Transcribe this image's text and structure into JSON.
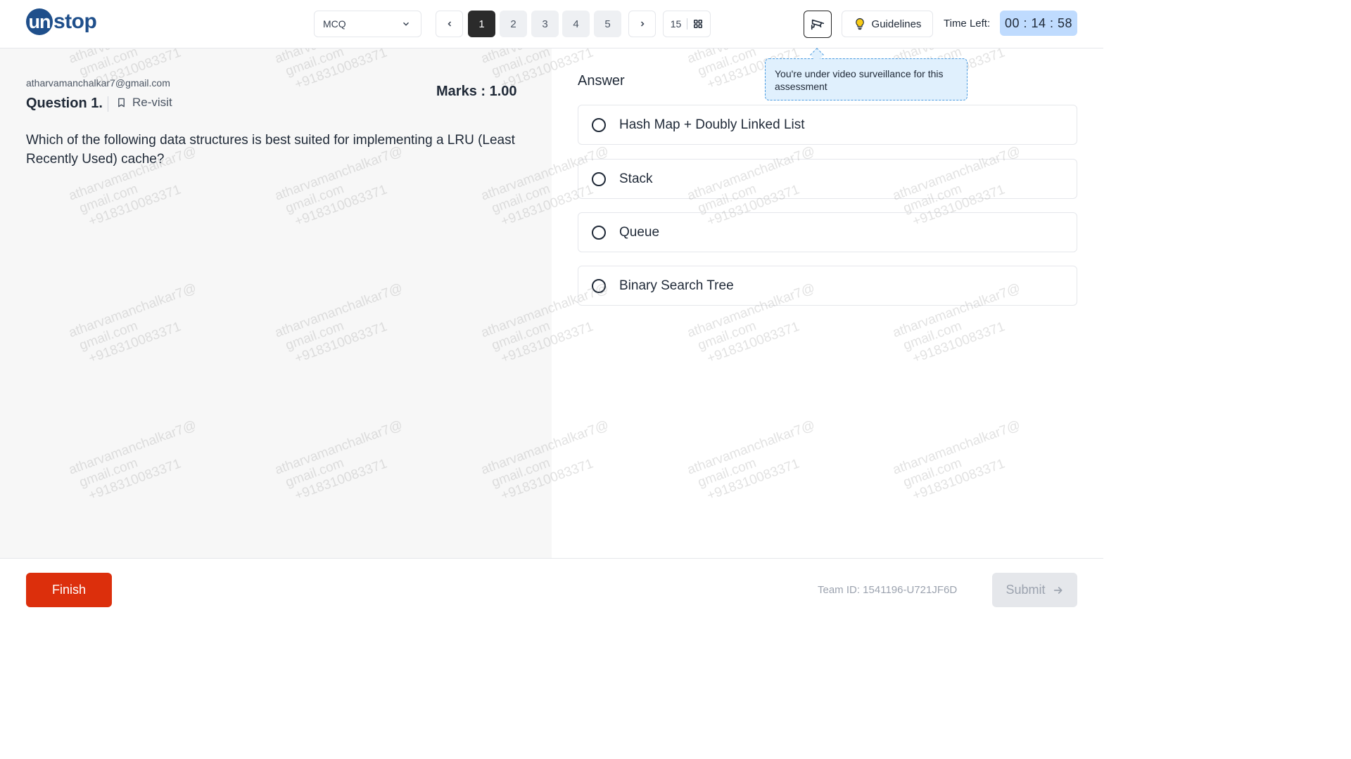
{
  "header": {
    "logo_prefix": "un",
    "logo_suffix": "stop",
    "section_select": "MCQ",
    "pages": [
      "1",
      "2",
      "3",
      "4",
      "5"
    ],
    "active_page": "1",
    "total_questions": "15",
    "guidelines_label": "Guidelines",
    "time_left_label": "Time Left:",
    "timer": "00 : 14 : 58"
  },
  "tooltip": {
    "text": "You're under video surveillance for this assessment"
  },
  "question": {
    "email": "atharvamanchalkar7@gmail.com",
    "title": "Question 1.",
    "revisit_label": "Re-visit",
    "marks": "Marks : 1.00",
    "text": "Which of the following data structures is best suited for implementing a LRU (Least Recently Used) cache?"
  },
  "answer": {
    "label": "Answer",
    "options": [
      "Hash Map + Doubly Linked List",
      "Stack",
      "Queue",
      "Binary Search Tree"
    ]
  },
  "watermark": {
    "line1": "atharvamanchalkar7@",
    "line2": "gmail.com",
    "line3": "+918310083371"
  },
  "footer": {
    "finish_label": "Finish",
    "team_id": "Team ID: 1541196-U721JF6D",
    "submit_label": "Submit"
  },
  "colors": {
    "brand": "#1f4f8b",
    "finish": "#dc2f0c",
    "timer_bg": "#bfdbfe",
    "tooltip_bg": "#e0f0fd"
  }
}
